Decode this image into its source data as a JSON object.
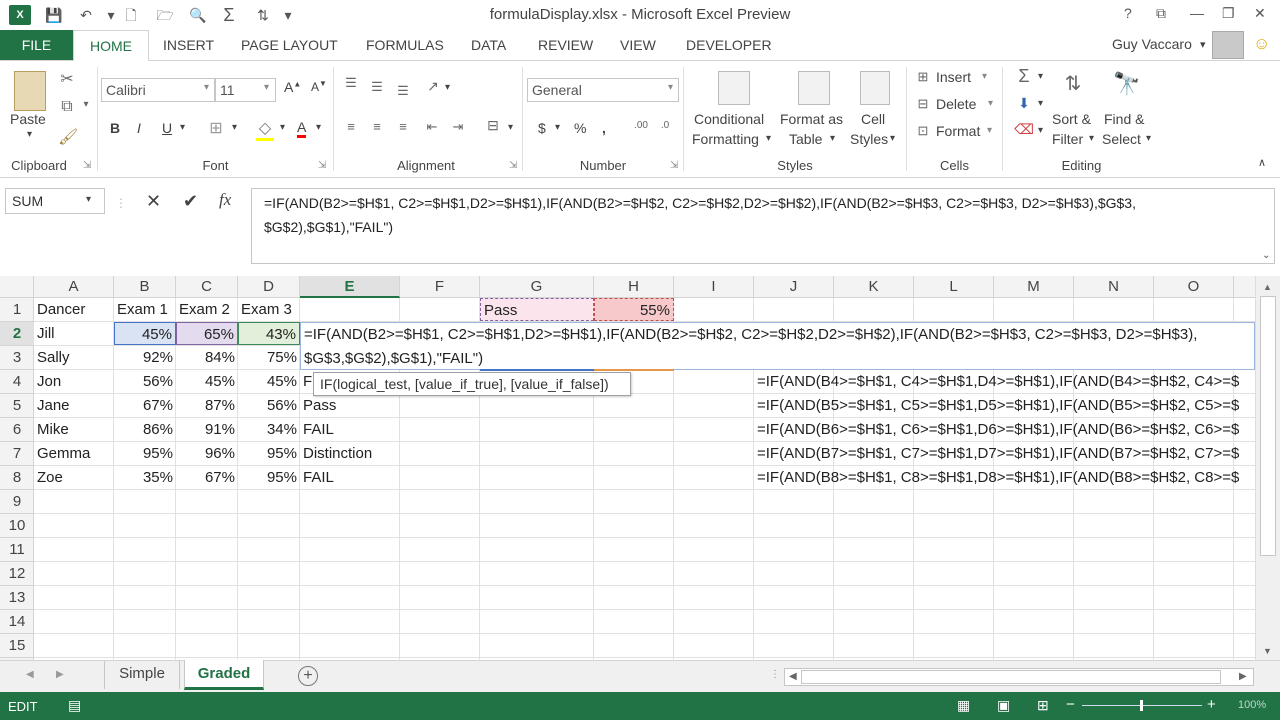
{
  "window": {
    "title": "formulaDisplay.xlsx - Microsoft Excel Preview",
    "help": "?",
    "minimize": "—",
    "restore": "❐",
    "close": "✕",
    "logo": "X"
  },
  "qat": {
    "save": "💾",
    "undo": "↶",
    "redo": "↷",
    "new": "🗋",
    "open": "🗁",
    "print_preview": "🔍",
    "autosum": "Σ",
    "sort": "⇅",
    "more": "▾"
  },
  "tabs": {
    "file": "FILE",
    "home": "HOME",
    "insert": "INSERT",
    "page_layout": "PAGE LAYOUT",
    "formulas": "FORMULAS",
    "data": "DATA",
    "review": "REVIEW",
    "view": "VIEW",
    "developer": "DEVELOPER"
  },
  "user": {
    "name": "Guy Vaccaro",
    "smiley": "☺"
  },
  "ribbon": {
    "clipboard": {
      "label": "Clipboard",
      "paste": "Paste"
    },
    "font": {
      "label": "Font",
      "name": "Calibri",
      "size": "11",
      "bold": "B",
      "italic": "I",
      "underline": "U"
    },
    "alignment": {
      "label": "Alignment"
    },
    "number": {
      "label": "Number",
      "format": "General",
      "currency": "$",
      "percent": "%",
      "comma": ","
    },
    "styles": {
      "label": "Styles",
      "conditional1": "Conditional",
      "conditional2": "Formatting",
      "format_table1": "Format as",
      "format_table2": "Table",
      "cell_styles1": "Cell",
      "cell_styles2": "Styles"
    },
    "cells": {
      "label": "Cells",
      "insert": "Insert",
      "delete": "Delete",
      "format": "Format"
    },
    "editing": {
      "label": "Editing",
      "sort1": "Sort &",
      "sort2": "Filter",
      "find1": "Find &",
      "find2": "Select"
    }
  },
  "formula_bar": {
    "name_box": "SUM",
    "cancel": "✕",
    "enter": "✔",
    "fx": "fx",
    "line1": "=IF(AND(B2>=$H$1, C2>=$H$1,D2>=$H$1),IF(AND(B2>=$H$2, C2>=$H$2,D2>=$H$2),IF(AND(B2>=$H$3, C2>=$H$3, D2>=$H$3),$G$3,",
    "line2": "$G$2),$G$1),\"FAIL\")"
  },
  "columns": [
    "A",
    "B",
    "C",
    "D",
    "E",
    "F",
    "G",
    "H",
    "I",
    "J",
    "K",
    "L",
    "M",
    "N",
    "O"
  ],
  "rows": [
    "1",
    "2",
    "3",
    "4",
    "5",
    "6",
    "7",
    "8",
    "9",
    "10",
    "11",
    "12",
    "13",
    "14",
    "15"
  ],
  "sheet": {
    "headers": {
      "a": "Dancer",
      "b": "Exam 1",
      "c": "Exam 2",
      "d": "Exam 3",
      "g": "Pass",
      "h": "55%"
    },
    "data": [
      {
        "name": "Jill",
        "e1": "45%",
        "e2": "65%",
        "e3": "43%",
        "e": ""
      },
      {
        "name": "Sally",
        "e1": "92%",
        "e2": "84%",
        "e3": "75%",
        "e": ""
      },
      {
        "name": "Jon",
        "e1": "56%",
        "e2": "45%",
        "e3": "45%",
        "e": "F"
      },
      {
        "name": "Jane",
        "e1": "67%",
        "e2": "87%",
        "e3": "56%",
        "e": "Pass"
      },
      {
        "name": "Mike",
        "e1": "86%",
        "e2": "91%",
        "e3": "34%",
        "e": "FAIL"
      },
      {
        "name": "Gemma",
        "e1": "95%",
        "e2": "96%",
        "e3": "95%",
        "e": "Distinction"
      },
      {
        "name": "Zoe",
        "e1": "35%",
        "e2": "67%",
        "e3": "95%",
        "e": "FAIL"
      }
    ],
    "edit_line1": "=IF(AND(B2>=$H$1, C2>=$H$1,D2>=$H$1),IF(AND(B2>=$H$2, C2>=$H$2,D2>=$H$2),IF(AND(B2>=$H$3, C2>=$H$3, D2>=$H$3),",
    "edit_line2": "$G$3,$G$2),$G$1),\"FAIL\")",
    "tooltip": "IF(logical_test, [value_if_true], [value_if_false])",
    "j_formulas": [
      "=IF(AND(B4>=$H$1, C4>=$H$1,D4>=$H$1),IF(AND(B4>=$H$2, C4>=$",
      "=IF(AND(B5>=$H$1, C5>=$H$1,D5>=$H$1),IF(AND(B5>=$H$2, C5>=$",
      "=IF(AND(B6>=$H$1, C6>=$H$1,D6>=$H$1),IF(AND(B6>=$H$2, C6>=$",
      "=IF(AND(B7>=$H$1, C7>=$H$1,D7>=$H$1),IF(AND(B7>=$H$2, C7>=$",
      "=IF(AND(B8>=$H$1, C8>=$H$1,D8>=$H$1),IF(AND(B8>=$H$2, C8>=$"
    ]
  },
  "sheet_tabs": [
    {
      "label": "Simple"
    },
    {
      "label": "Graded"
    }
  ],
  "status": {
    "mode": "EDIT",
    "zoom": "100%"
  },
  "colors": {
    "accent": "#217346",
    "ref_blue": "#4472c4",
    "ref_purple": "#8064a2",
    "ref_red": "#c0504d",
    "ref_orange": "#b5863f"
  }
}
